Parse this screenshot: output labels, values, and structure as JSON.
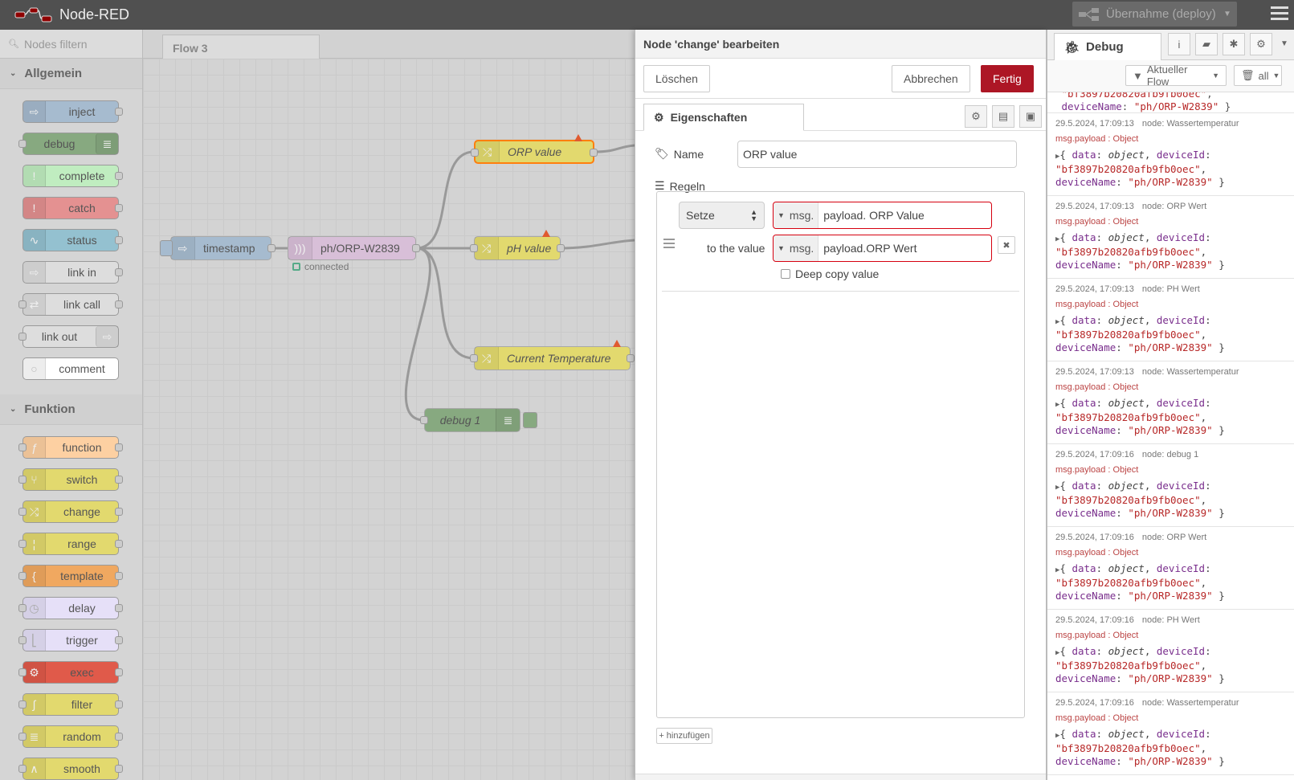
{
  "app": {
    "title": "Node-RED"
  },
  "header": {
    "deploy_label": "Übernahme (deploy)"
  },
  "palette": {
    "search_placeholder": "Nodes filtern",
    "categories": [
      {
        "label": "Allgemein",
        "nodes": [
          {
            "label": "inject",
            "color": "#a6bbcf"
          },
          {
            "label": "debug",
            "color": "#87a980"
          },
          {
            "label": "complete",
            "color": "#c0edc0"
          },
          {
            "label": "catch",
            "color": "#e49191"
          },
          {
            "label": "status",
            "color": "#94c1d0"
          },
          {
            "label": "link in",
            "color": "#dddddd"
          },
          {
            "label": "link call",
            "color": "#dddddd"
          },
          {
            "label": "link out",
            "color": "#dddddd"
          },
          {
            "label": "comment",
            "color": "#ffffff"
          }
        ]
      },
      {
        "label": "Funktion",
        "nodes": [
          {
            "label": "function",
            "color": "#fdd0a2"
          },
          {
            "label": "switch",
            "color": "#e2d96e"
          },
          {
            "label": "change",
            "color": "#e2d96e"
          },
          {
            "label": "range",
            "color": "#e2d96e"
          },
          {
            "label": "template",
            "color": "#f0a860"
          },
          {
            "label": "delay",
            "color": "#e6e0f8"
          },
          {
            "label": "trigger",
            "color": "#e6e0f8"
          },
          {
            "label": "exec",
            "color": "#e05a4a"
          },
          {
            "label": "filter",
            "color": "#e2d96e"
          },
          {
            "label": "random",
            "color": "#e2d96e"
          },
          {
            "label": "smooth",
            "color": "#e2d96e"
          }
        ]
      }
    ]
  },
  "workspace": {
    "tab": "Flow 3",
    "nodes": {
      "timestamp": "timestamp",
      "mqtt": "ph/ORP-W2839",
      "mqtt_status": "connected",
      "orp": "ORP value",
      "ph": "pH value",
      "temp": "Current Temperature",
      "debug": "debug 1"
    }
  },
  "editor": {
    "title": "Node 'change' bearbeiten",
    "delete_label": "Löschen",
    "cancel_label": "Abbrechen",
    "done_label": "Fertig",
    "tab_label": "Eigenschaften",
    "name_label": "Name",
    "name_value": "ORP value",
    "rules_label": "Regeln",
    "rule": {
      "action": "Setze",
      "target_prefix": "msg.",
      "target_value": "payload. ORP Value",
      "to_label": "to the value",
      "source_prefix": "msg.",
      "source_value": "payload.ORP Wert",
      "deep_copy_label": "Deep copy value"
    },
    "add_label": "hinzufügen"
  },
  "sidebar": {
    "tab_label": "Debug",
    "filter_label": "Aktueller Flow",
    "clear_label": "all",
    "partial_top": {
      "key": "deviceName",
      "value": "\"ph/ORP-W2839\""
    },
    "messages": [
      {
        "time": "29.5.2024, 17:09:13",
        "node": "node: Wassertemperatur",
        "topic": "msg.payload : Object"
      },
      {
        "time": "29.5.2024, 17:09:13",
        "node": "node: ORP Wert",
        "topic": "msg.payload : Object"
      },
      {
        "time": "29.5.2024, 17:09:13",
        "node": "node: PH Wert",
        "topic": "msg.payload : Object"
      },
      {
        "time": "29.5.2024, 17:09:13",
        "node": "node: Wassertemperatur",
        "topic": "msg.payload : Object"
      },
      {
        "time": "29.5.2024, 17:09:16",
        "node": "node: debug 1",
        "topic": "msg.payload : Object"
      },
      {
        "time": "29.5.2024, 17:09:16",
        "node": "node: ORP Wert",
        "topic": "msg.payload : Object"
      },
      {
        "time": "29.5.2024, 17:09:16",
        "node": "node: PH Wert",
        "topic": "msg.payload : Object"
      },
      {
        "time": "29.5.2024, 17:09:16",
        "node": "node: Wassertemperatur",
        "topic": "msg.payload : Object"
      }
    ],
    "payload": {
      "key_data": "data",
      "type_data": "object",
      "key_device_id": "deviceId",
      "device_id": "\"bf3897b20820afb9fb0oec\"",
      "key_device_name": "deviceName",
      "device_name": "\"ph/ORP-W2839\""
    }
  },
  "colors": {
    "accent": "#ad1625",
    "header": "#505050",
    "change_node": "#e2d96e",
    "mqtt_node": "#d8bfd8",
    "error_border": "#d6000f"
  }
}
